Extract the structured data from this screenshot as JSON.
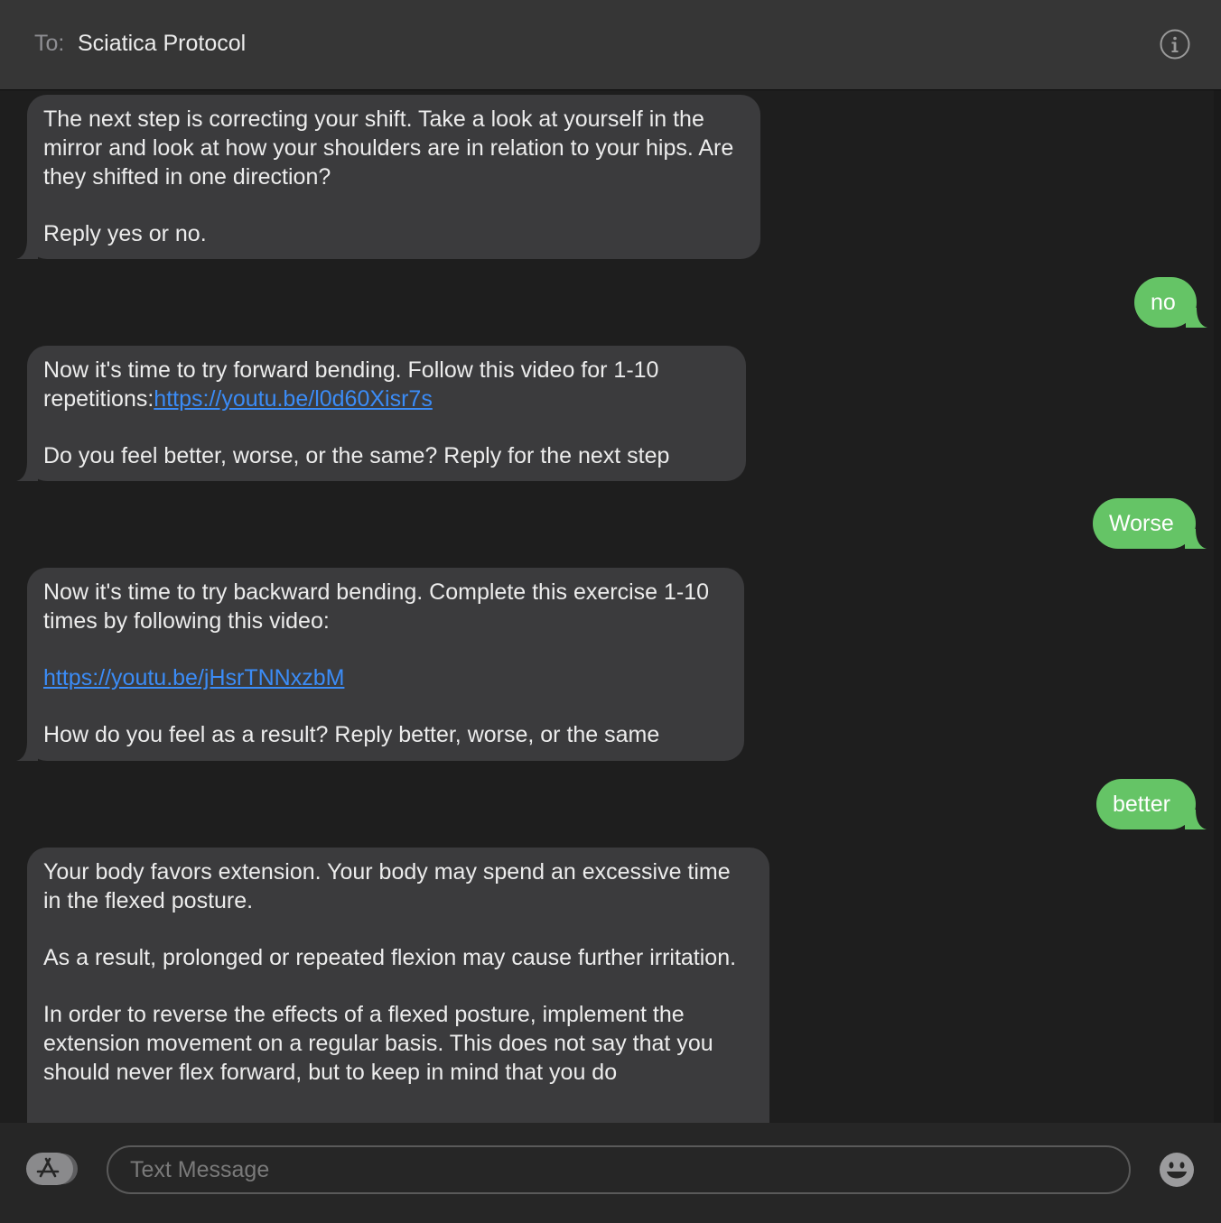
{
  "header": {
    "to_label": "To:",
    "recipient": "Sciatica Protocol"
  },
  "messages": [
    {
      "direction": "incoming",
      "paragraphs": [
        "The next step is correcting your shift. Take a look at yourself in the mirror and look at how your shoulders are in relation to your hips. Are they shifted in one direction?",
        "Reply yes or no."
      ]
    },
    {
      "direction": "outgoing",
      "text": "no"
    },
    {
      "direction": "incoming",
      "line1": "Now it's time to try forward bending. Follow this video for 1-10",
      "line2_prefix": "repetitions:",
      "link": "https://youtu.be/l0d60Xisr7s",
      "line3": "Do you feel better, worse, or the same? Reply for the next step"
    },
    {
      "direction": "outgoing",
      "text": "Worse"
    },
    {
      "direction": "incoming",
      "line1": "Now it's time to try backward bending. Complete this exercise 1-10 times by following this video:",
      "link": "https://youtu.be/jHsrTNNxzbM",
      "line3": "How do you feel as a result? Reply better, worse, or the same"
    },
    {
      "direction": "outgoing",
      "text": "better"
    },
    {
      "direction": "incoming",
      "paragraphs": [
        "Your body favors extension. Your body may spend an excessive time in the flexed posture.",
        "As a result, prolonged or repeated flexion may cause further irritation.",
        "In order to reverse the effects of a flexed posture, implement the extension movement on a regular basis. This does not say that you should never flex forward, but to keep in mind that you do"
      ]
    }
  ],
  "compose": {
    "placeholder": "Text Message"
  },
  "colors": {
    "incoming_bubble": "#3b3b3d",
    "outgoing_bubble": "#65c466",
    "link": "#3b8cf7",
    "background": "#1e1e1e"
  },
  "icons": {
    "info": "info-circle-icon",
    "apps": "app-store-icon",
    "emoji": "emoji-smiley-icon"
  }
}
